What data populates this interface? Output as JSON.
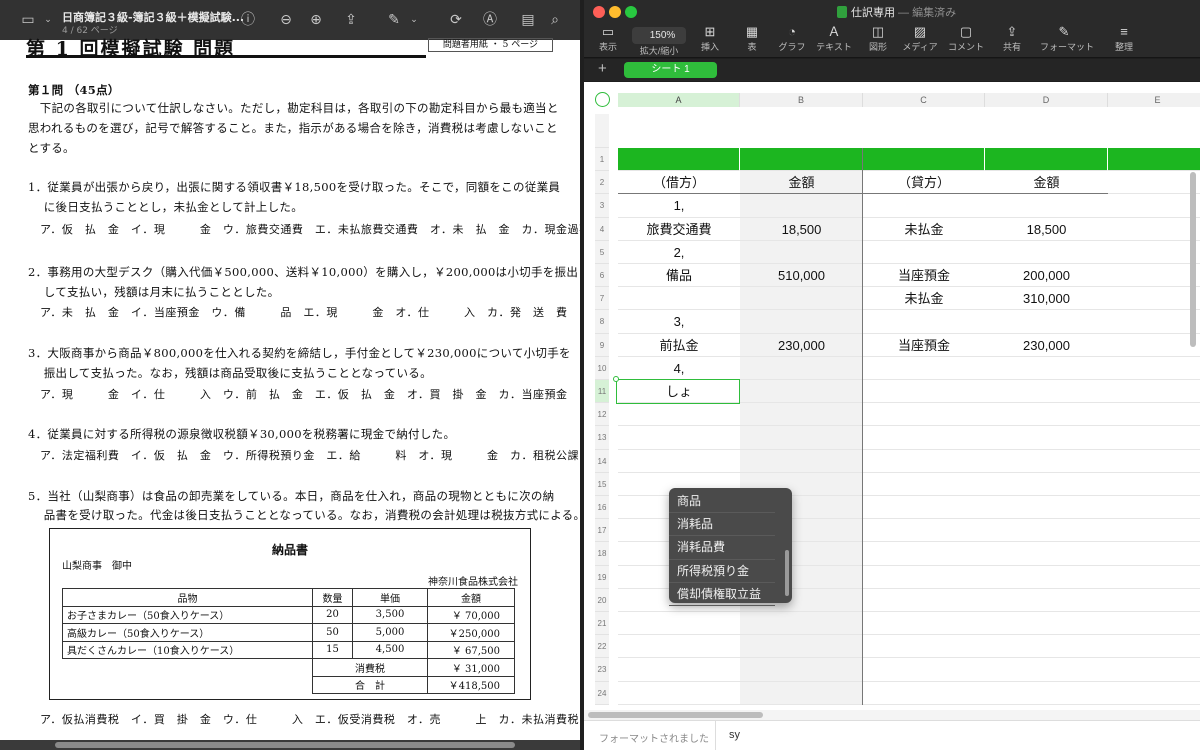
{
  "pdf": {
    "title": "日商簿記３級-簿記３級＋模擬試験...",
    "page_info": "4 / 62 ページ",
    "heading": "第 1 回模擬試験 問題",
    "heading_tag": "問題者用紙 ・ 5 ページ",
    "q1_header": "第１問 （45点）",
    "intro": [
      "　下記の各取引について仕訳しなさい。ただし，勘定科目は，各取引の下の勘定科目から最も適当と",
      "思われるものを選び，記号で解答すること。また，指示がある場合を除き，消費税は考慮しないこと",
      "とする。"
    ],
    "questions": [
      {
        "lines": [
          "1．従業員が出張から戻り，出張に関する領収書￥18,500を受け取った。そこで，同額をこの従業員",
          "　 に後日支払うこととし，未払金として計上した。"
        ],
        "options": "ア．仮　払　金　イ．現　　　金　ウ．旅費交通費　エ．未払旅費交通費　オ．未　払　金　カ．現金過不足"
      },
      {
        "lines": [
          "2．事務用の大型デスク（購入代価￥500,000、送料￥10,000）を購入し，￥200,000は小切手を振出",
          "　 して支払い，残額は月末に払うこととした。"
        ],
        "options": "ア．未　払　金　イ．当座預金　ウ．備　　　品　エ．現　　　金　オ．仕　　　入　カ．発　送　費"
      },
      {
        "lines": [
          "3．大阪商事から商品￥800,000を仕入れる契約を締結し，手付金として￥230,000について小切手を",
          "　 振出して支払った。なお，残額は商品受取後に支払うこととなっている。"
        ],
        "options": "ア．現　　　金　イ．仕　　　入　ウ．前　払　金　エ．仮　払　金　オ．買　掛　金　カ．当座預金"
      },
      {
        "lines": [
          "4．従業員に対する所得税の源泉徴収税額￥30,000を税務署に現金で納付した。"
        ],
        "options": "ア．法定福利費　イ．仮　払　金　ウ．所得税預り金　エ．給　　　料　オ．現　　　金　カ．租税公課"
      },
      {
        "lines": [
          "5．当社（山梨商事）は食品の卸売業をしている。本日，商品を仕入れ，商品の現物とともに次の納",
          "　 品書を受け取った。代金は後日支払うこととなっている。なお，消費税の会計処理は税抜方式による。"
        ],
        "options": "ア．仮払消費税　イ．買　掛　金　ウ．仕　　　入　エ．仮受消費税　オ．売　　　上　カ．未払消費税"
      }
    ],
    "delivery_note": {
      "title": "納品書",
      "to": "山梨商事　御中",
      "from": "神奈川食品株式会社",
      "headers": [
        "品物",
        "数量",
        "単価",
        "金額"
      ],
      "rows": [
        [
          "お子さまカレー（50食入りケース）",
          "20",
          "3,500",
          "￥  70,000"
        ],
        [
          "高級カレー（50食入りケース）",
          "50",
          "5,000",
          "￥250,000"
        ],
        [
          "具だくさんカレー（10食入りケース）",
          "15",
          "4,500",
          "￥  67,500"
        ]
      ],
      "tax_label": "消費税",
      "tax_value": "￥  31,000",
      "total_label": "合　計",
      "total_value": "￥418,500"
    }
  },
  "numbers": {
    "doc_title": "仕訳専用",
    "doc_status": " — 編集済み",
    "zoom": "150%",
    "toolbar": [
      {
        "label": "表示",
        "icon": "sidebar-icon",
        "glyph": "▭"
      },
      {
        "label": "拡大/縮小",
        "icon": "zoom-icon",
        "glyph": ""
      },
      {
        "label": "挿入",
        "icon": "insert-icon",
        "glyph": "⊞"
      },
      {
        "label": "表",
        "icon": "table-icon",
        "glyph": "▦"
      },
      {
        "label": "グラフ",
        "icon": "chart-icon",
        "glyph": "◔"
      },
      {
        "label": "テキスト",
        "icon": "text-icon",
        "glyph": "Ａ"
      },
      {
        "label": "図形",
        "icon": "shape-icon",
        "glyph": "◫"
      },
      {
        "label": "メディア",
        "icon": "media-icon",
        "glyph": "▨"
      },
      {
        "label": "コメント",
        "icon": "comment-icon",
        "glyph": "▢"
      },
      {
        "label": "共有",
        "icon": "share-icon",
        "glyph": "⇪"
      },
      {
        "label": "フォーマット",
        "icon": "format-brush-icon",
        "glyph": "✎"
      },
      {
        "label": "整理",
        "icon": "organize-icon",
        "glyph": "≡"
      }
    ],
    "sheet_tab": "シート 1",
    "columns": [
      "A",
      "B",
      "C",
      "D",
      "E"
    ],
    "header_row": [
      "（借方）",
      "金額",
      "（貸方）",
      "金額"
    ],
    "rows": [
      [
        "",
        "",
        "",
        ""
      ],
      [
        "（借方）",
        "金額",
        "（貸方）",
        "金額"
      ],
      [
        "1,",
        "",
        "",
        ""
      ],
      [
        "旅費交通費",
        "18,500",
        "未払金",
        "18,500"
      ],
      [
        "2,",
        "",
        "",
        ""
      ],
      [
        "備品",
        "510,000",
        "当座預金",
        "200,000"
      ],
      [
        "",
        "",
        "未払金",
        "310,000"
      ],
      [
        "3,",
        "",
        "",
        ""
      ],
      [
        "前払金",
        "230,000",
        "当座預金",
        "230,000"
      ],
      [
        "4,",
        "",
        "",
        ""
      ],
      [
        "しょ",
        "",
        "",
        ""
      ],
      [
        "",
        "",
        "",
        ""
      ],
      [
        "",
        "",
        "",
        ""
      ],
      [
        "",
        "",
        "",
        ""
      ],
      [
        "",
        "",
        "",
        ""
      ],
      [
        "",
        "",
        "",
        ""
      ],
      [
        "",
        "",
        "",
        ""
      ],
      [
        "",
        "",
        "",
        ""
      ],
      [
        "",
        "",
        "",
        ""
      ],
      [
        "",
        "",
        "",
        ""
      ],
      [
        "",
        "",
        "",
        ""
      ],
      [
        "",
        "",
        "",
        ""
      ],
      [
        "",
        "",
        "",
        ""
      ],
      [
        "",
        "",
        "",
        ""
      ]
    ],
    "autocomplete": [
      "商品",
      "消耗品",
      "消耗品費",
      "所得税預り金",
      "償却債権取立益"
    ],
    "status_left": "フォーマットされました",
    "status_input": "sy",
    "accent_color": "#2fbd3b",
    "header_fill_color": "#1cb620"
  }
}
